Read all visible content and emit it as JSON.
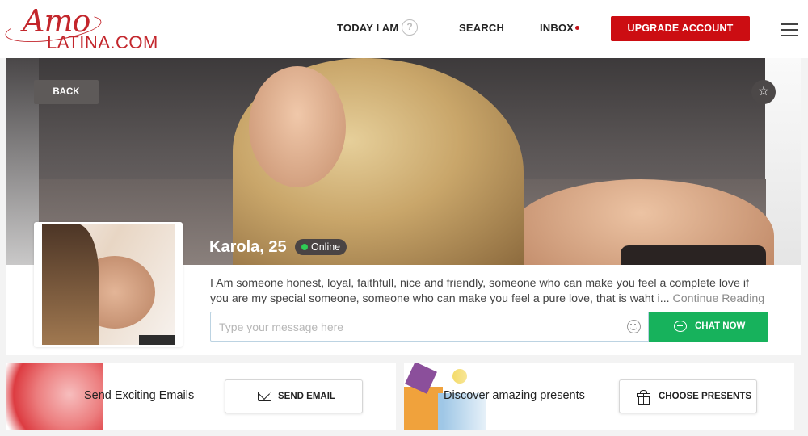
{
  "header": {
    "logo_script": "Amo",
    "logo_main": "LATINA.COM",
    "nav": {
      "today": "TODAY I AM",
      "help_icon": "?",
      "search": "SEARCH",
      "inbox": "INBOX"
    },
    "upgrade_label": "UPGRADE ACCOUNT",
    "menu_icon": "hamburger-menu-icon"
  },
  "profile": {
    "back_label": "BACK",
    "star_icon": "☆",
    "name_age": "Karola, 25",
    "status": "Online",
    "bio": "I Am someone honest, loyal, faithfull, nice and friendly, someone who can make you feel a complete love if you are my special someone, someone who can make you feel a pure love, that is waht i...",
    "continue_label": "Continue Reading",
    "message_placeholder": "Type your message here",
    "chat_label": "CHAT NOW"
  },
  "promos": {
    "email": {
      "text": "Send Exciting Emails",
      "button": "SEND EMAIL"
    },
    "gift": {
      "text": "Discover amazing presents",
      "button": "CHOOSE PRESENTS"
    }
  },
  "colors": {
    "brand_red": "#cc0d12",
    "chat_green": "#17b25c",
    "online_green": "#2ecc55"
  }
}
